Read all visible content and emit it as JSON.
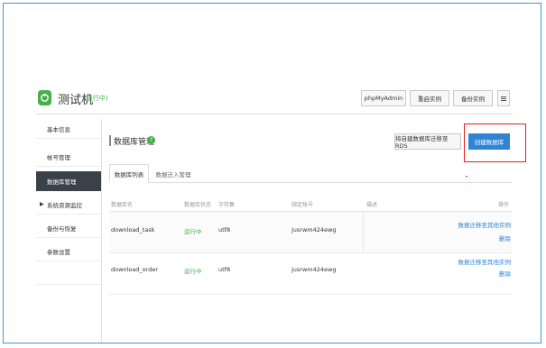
{
  "header": {
    "title": "测试机",
    "status": "(运行中)",
    "buttons": [
      "phpMyAdmin",
      "重启实例",
      "备份实例"
    ]
  },
  "sidebar": {
    "items": [
      {
        "label": "基本信息",
        "active": false
      },
      {
        "label": "帐号管理",
        "active": false
      },
      {
        "label": "数据库管理",
        "active": true
      },
      {
        "label": "系统资源监控",
        "active": false,
        "expandable": true
      },
      {
        "label": "备份与恢复",
        "active": false
      },
      {
        "label": "参数设置",
        "active": false
      },
      {
        "label": "",
        "active": false
      }
    ]
  },
  "main": {
    "section_title": "数据库管理",
    "migrate_button": "将自建数据库迁移至RDS",
    "create_button": "创建数据库",
    "tabs": [
      "数据库列表",
      "数据迁入管理"
    ],
    "table": {
      "columns": [
        "数据库名",
        "数据库状态",
        "字符集",
        "绑定帐号",
        "描述",
        "操作"
      ],
      "rows": [
        {
          "name": "download_task",
          "status": "运行中",
          "charset": "utf8",
          "account": "jusrwm424ewg",
          "desc": "",
          "actions": [
            "数据迁移至其他实例",
            "删除"
          ]
        },
        {
          "name": "download_order",
          "status": "运行中",
          "charset": "utf8",
          "account": "jusrwm424ewg",
          "desc": "",
          "actions": [
            "数据迁移至其他实例",
            "删除"
          ]
        }
      ]
    }
  },
  "colors": {
    "accent": "#2f85d3",
    "success": "#45b049",
    "highlight": "#e02020",
    "sidebar_active": "#3b4148"
  }
}
